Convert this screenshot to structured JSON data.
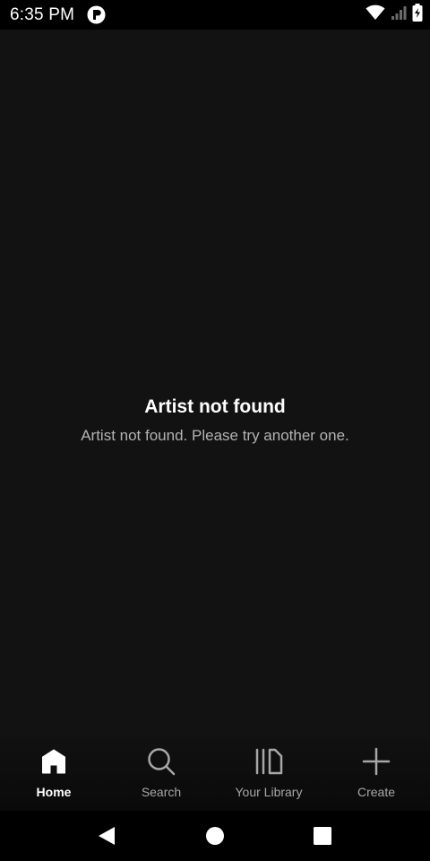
{
  "status_bar": {
    "time": "6:35 PM",
    "app_icon": "app-notification-icon",
    "icons": [
      "wifi-icon",
      "cellular-signal-icon",
      "battery-charging-icon"
    ]
  },
  "main": {
    "title": "Artist not found",
    "subtitle": "Artist not found. Please try another one."
  },
  "bottom_nav": {
    "items": [
      {
        "label": "Home",
        "icon": "home-icon",
        "active": true
      },
      {
        "label": "Search",
        "icon": "search-icon",
        "active": false
      },
      {
        "label": "Your Library",
        "icon": "library-icon",
        "active": false
      },
      {
        "label": "Create",
        "icon": "plus-icon",
        "active": false
      }
    ]
  },
  "system_nav": {
    "icons": [
      "back-icon",
      "home-circle-icon",
      "recents-icon"
    ]
  },
  "colors": {
    "background": "#121212",
    "text_primary": "#ffffff",
    "text_secondary": "#b3b3b3",
    "nav_inactive": "#a7a7a7"
  }
}
